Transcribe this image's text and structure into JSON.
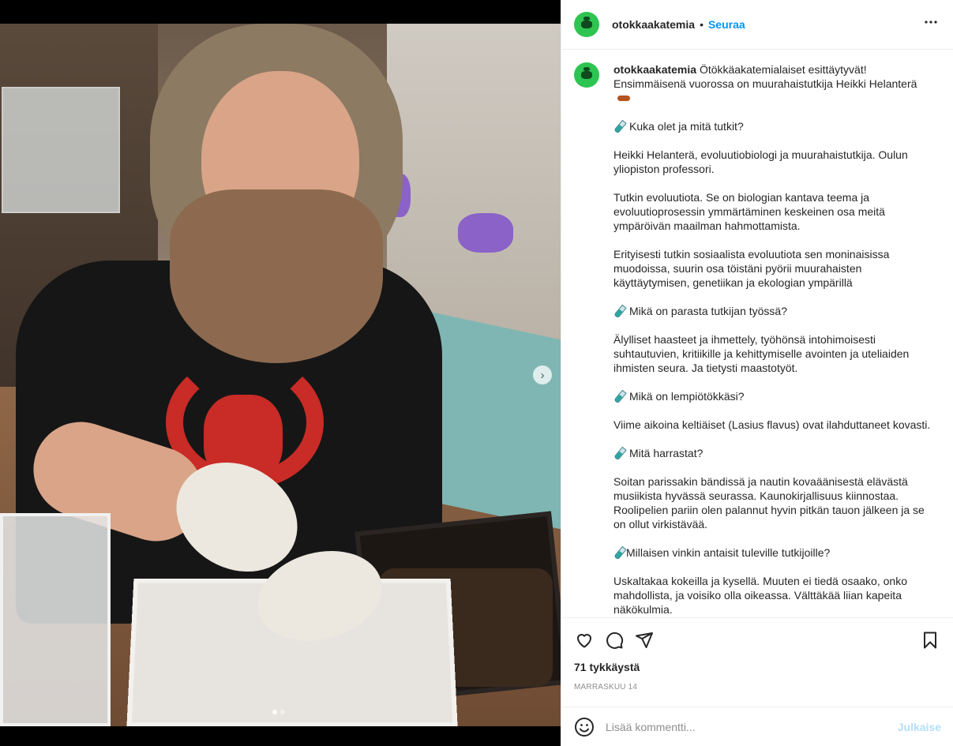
{
  "header": {
    "username": "otokkaakatemia",
    "separator": "•",
    "follow_label": "Seuraa",
    "more_label": "•••"
  },
  "caption": {
    "username": "otokkaakatemia",
    "intro_line1": "Ötökkäakatemialaiset esittäytyvät!",
    "intro_line2": "Ensimmäisenä vuorossa on muurahaistutkija Heikki Helanterä",
    "q1": "Kuka olet ja mitä tutkit?",
    "a1": "Heikki Helanterä, evoluutiobiologi ja muurahaistutkija. Oulun yliopiston professori.",
    "a1b": "Tutkin evoluutiota. Se on biologian kantava teema ja evoluutioprosessin ymmärtäminen keskeinen osa meitä ympäröivän maailman hahmottamista.",
    "a1c": "Erityisesti tutkin sosiaalista evoluutiota sen moninaisissa muodoissa, suurin osa töistäni pyörii muurahaisten käyttäytymisen, genetiikan ja ekologian ympärillä",
    "q2": "Mikä on parasta tutkijan työssä?",
    "a2": "Älylliset haasteet ja ihmettely, työhönsä intohimoisesti suhtautuvien, kritiikille ja kehittymiselle avointen ja uteliaiden ihmisten seura. Ja tietysti maastotyöt.",
    "q3": "Mikä on lempiötökkäsi?",
    "a3": "Viime aikoina keltiäiset (Lasius flavus) ovat ilahduttaneet kovasti.",
    "q4": "Mitä harrastat?",
    "a4": "Soitan parissakin bändissä ja nautin kovaäänisestä elävästä musiikista hyvässä seurassa. Kaunokirjallisuus kiinnostaa. Roolipelien pariin olen palannut hyvin pitkän tauon jälkeen ja se on ollut virkistävää.",
    "q5": "Millaisen vinkin antaisit tuleville tutkijoille?",
    "a5": "Uskaltakaa kokeilla ja kysellä. Muuten ei tiedä osaako, onko mahdollista, ja voisiko olla oikeassa. Välttäkää liian kapeita näkökulmia."
  },
  "icons": {
    "like": "heart-icon",
    "comment": "comment-icon",
    "share": "paper-plane-icon",
    "save": "bookmark-icon",
    "emoji": "emoji-icon",
    "next": "chevron-right-icon",
    "question_marker": "test-tube-icon",
    "ant": "ant-icon"
  },
  "media": {
    "next_glyph": "›",
    "carousel_total": 2,
    "carousel_active": 1
  },
  "stats": {
    "likes": "71 tykkäystä",
    "date": "MARRASKUU 14"
  },
  "comment": {
    "placeholder": "Lisää kommentti...",
    "post_label": "Julkaise"
  },
  "colors": {
    "accent": "#0095f6",
    "post_disabled": "#b2dffc",
    "avatar": "#2ec452"
  }
}
